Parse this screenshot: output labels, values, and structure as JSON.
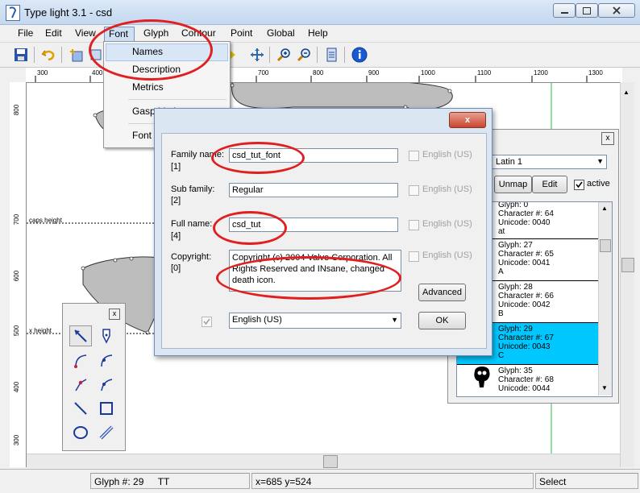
{
  "window": {
    "title": "Type light 3.1  -  csd",
    "minimize_icon": "minimize-icon",
    "restore_icon": "restore-icon",
    "close_icon": "close-icon"
  },
  "menubar": {
    "items": [
      "File",
      "Edit",
      "View",
      "Font",
      "Glyph",
      "Contour",
      "Point",
      "Global",
      "Help"
    ]
  },
  "font_menu": {
    "items": [
      "Names",
      "Description",
      "Metrics",
      "Gasp hinting",
      "Font options"
    ]
  },
  "ruler": {
    "h_labels": [
      "300",
      "400",
      "700",
      "800",
      "900",
      "1000",
      "1100",
      "1200",
      "1300"
    ],
    "v_labels": [
      "800",
      "700",
      "600",
      "500",
      "400",
      "300"
    ],
    "guide_caps": "caps height",
    "guide_x": "x height"
  },
  "names_dialog": {
    "family_label": "Family name:",
    "family_id": "[1]",
    "family_value": "csd_tut_font",
    "sub_label": "Sub family:",
    "sub_id": "[2]",
    "sub_value": "Regular",
    "full_label": "Full name:",
    "full_id": "[4]",
    "full_value": "csd_tut",
    "copyright_label": "Copyright:",
    "copyright_id": "[0]",
    "copyright_value": "Copyright (c) 2004 Valve Corporation. All Rights Reserved and INsane, changed death icon.",
    "lang_check_label": "English (US)",
    "language_select": "English (US)",
    "advanced_button": "Advanced",
    "ok_button": "OK",
    "close_symbol": "x"
  },
  "glyph_panel": {
    "encoding": "Latin 1",
    "unmap_button": "Unmap",
    "edit_button": "Edit",
    "active_label": "active",
    "close_symbol": "x",
    "glyphs": [
      {
        "glyph": "Glyph: 0",
        "char": "Character #: 64",
        "unicode": "Unicode: 0040",
        "name": "at"
      },
      {
        "glyph": "Glyph: 27",
        "char": "Character #: 65",
        "unicode": "Unicode: 0041",
        "name": "A"
      },
      {
        "glyph": "Glyph: 28",
        "char": "Character #: 66",
        "unicode": "Unicode: 0042",
        "name": "B"
      },
      {
        "glyph": "Glyph: 29",
        "char": "Character #: 67",
        "unicode": "Unicode: 0043",
        "name": "C"
      },
      {
        "glyph": "Glyph: 35",
        "char": "Character #: 68",
        "unicode": "Unicode: 0044",
        "name": ""
      }
    ],
    "selected_color": "#00c8ff"
  },
  "palette": {
    "close_symbol": "x"
  },
  "statusbar": {
    "glyph": "Glyph #: 29",
    "tt": "TT",
    "coords": "x=685  y=524",
    "mode": "Select"
  },
  "colors": {
    "annotation_ring": "#e02020",
    "glyph_fill": "#bdbdbd"
  }
}
